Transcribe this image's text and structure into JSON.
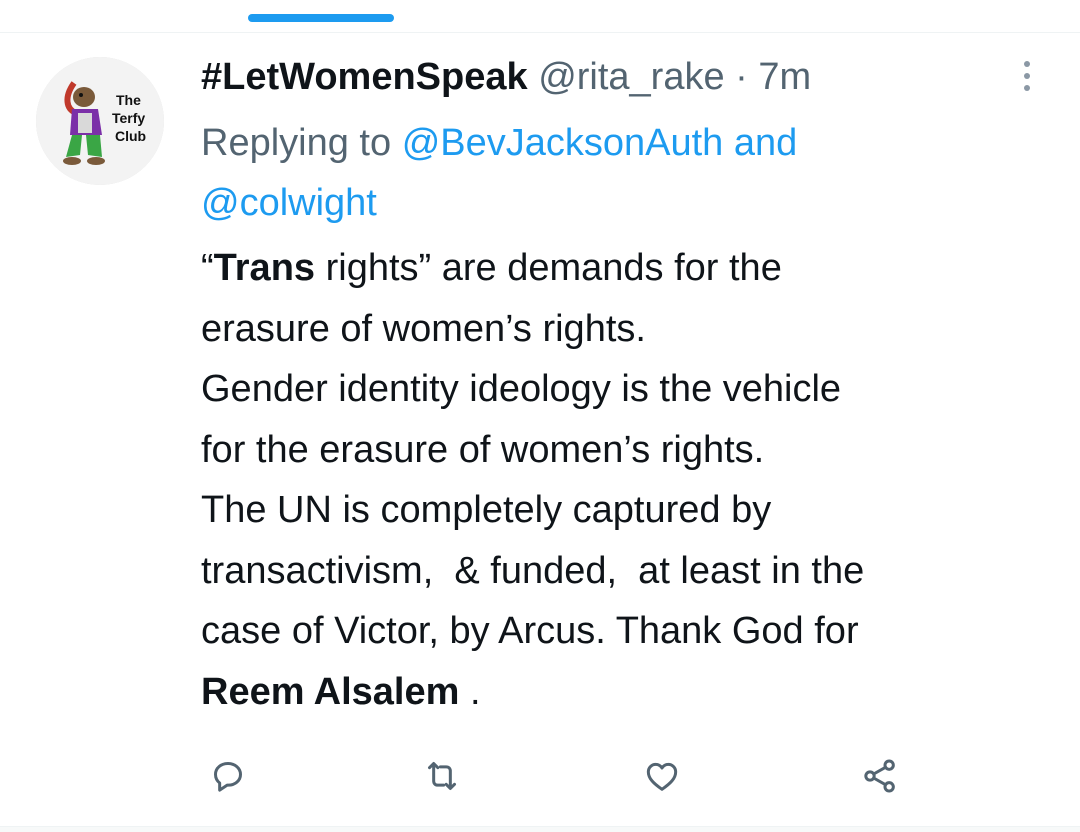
{
  "tweet": {
    "display_name": "#LetWomenSpeak",
    "handle": "@rita_rake",
    "separator": "·",
    "time": "7m",
    "reply": {
      "prefix": "Replying to",
      "mention1": "@BevJacksonAuth",
      "conjunction": "and",
      "mention2": "@colwight"
    },
    "avatar_text": [
      "The",
      "Terfy",
      "Club"
    ],
    "body": {
      "l1_open": "“",
      "l1_bold": "Trans",
      "l1_rest": " rights” are demands for the",
      "l2": "erasure of women’s rights.",
      "l3": "Gender identity ideology is the vehicle",
      "l4": "for the erasure of women’s rights.",
      "l5": "The UN is completely captured by",
      "l6": "transactivism,  & funded,  at least in the",
      "l7": "case of Victor, by Arcus. Thank God for",
      "l8_bold": "Reem Alsalem",
      "l8_rest": " ."
    }
  },
  "icons": {
    "more": "more-vertical-icon",
    "reply": "reply-icon",
    "retweet": "retweet-icon",
    "like": "like-icon",
    "share": "share-icon"
  },
  "colors": {
    "accent": "#1d9bf0",
    "text": "#0f1419",
    "secondary": "#536471",
    "icon": "#536471"
  }
}
